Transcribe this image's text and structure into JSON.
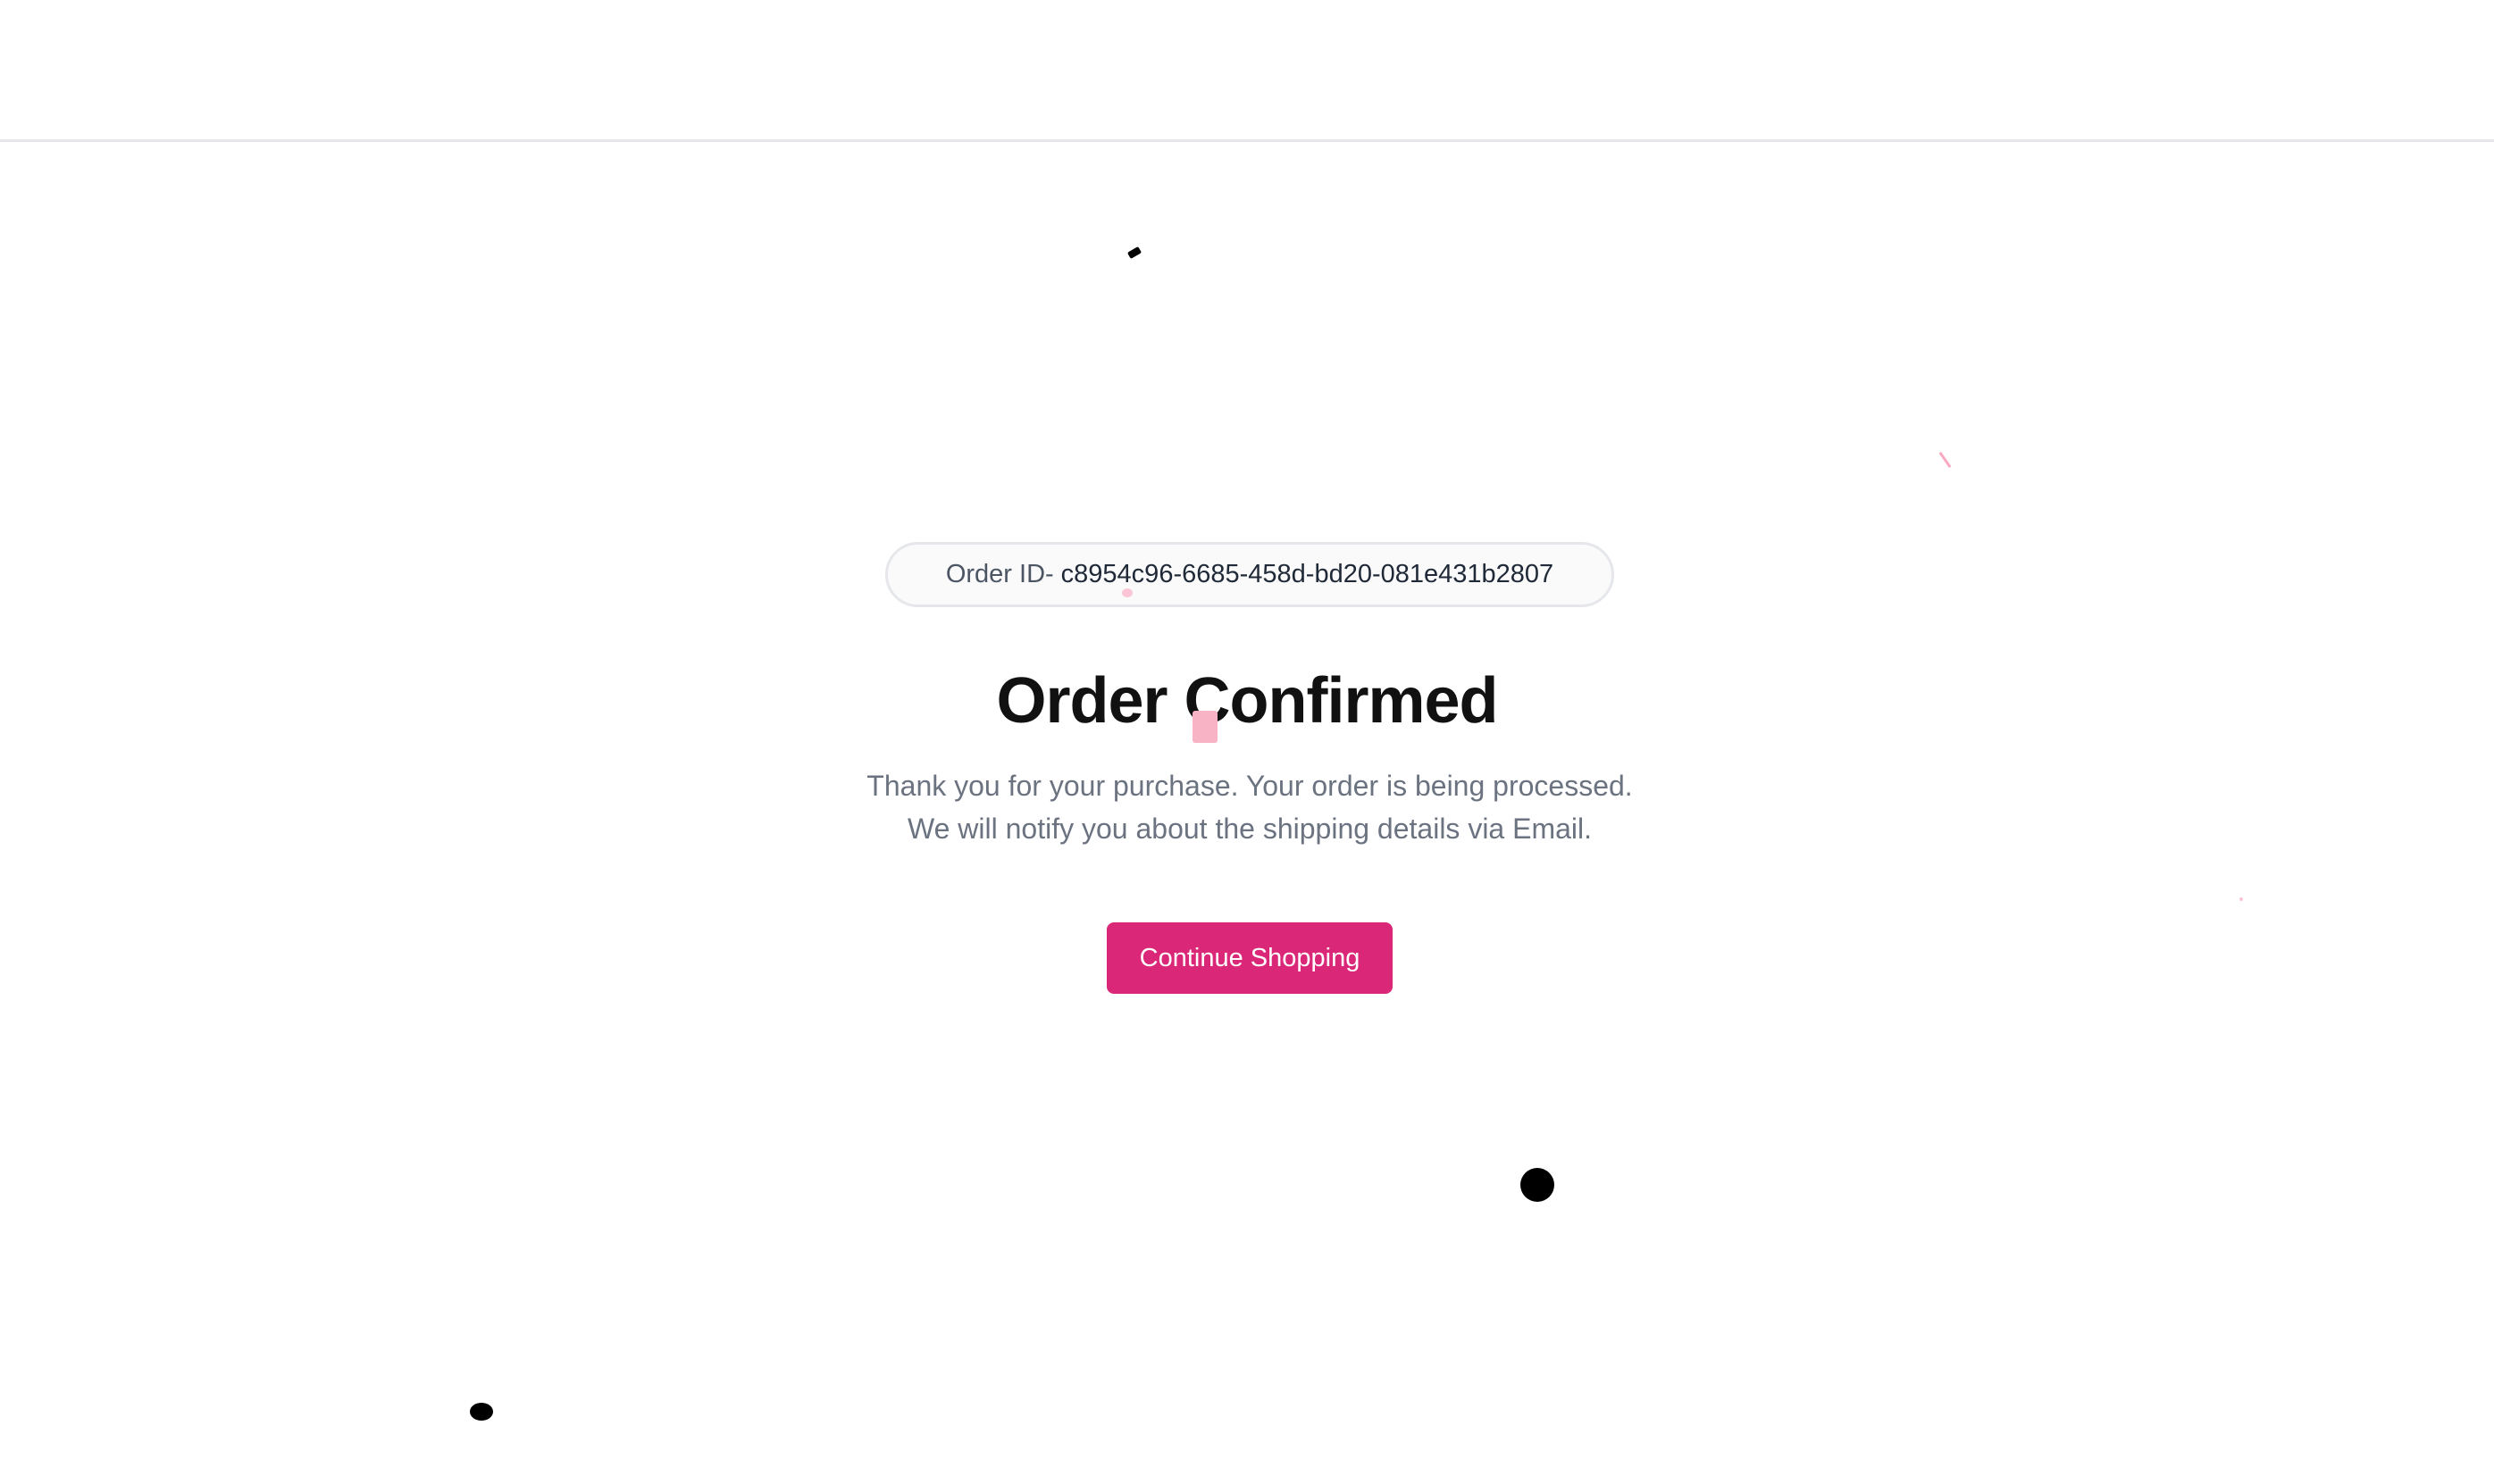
{
  "header": {},
  "order": {
    "id_prefix": "Order ID-",
    "id_value": "c8954c96-6685-458d-bd20-081e431b2807"
  },
  "confirmation": {
    "title": "Order Confirmed",
    "message": "Thank you for your purchase. Your order is being processed. We will notify you about the shipping details via Email.",
    "continue_label": "Continue Shopping"
  },
  "colors": {
    "accent": "#db2777",
    "title_text": "#111111",
    "body_text": "#6b7280",
    "confetti_pink": "#f8b4c4",
    "confetti_black": "#000000"
  }
}
